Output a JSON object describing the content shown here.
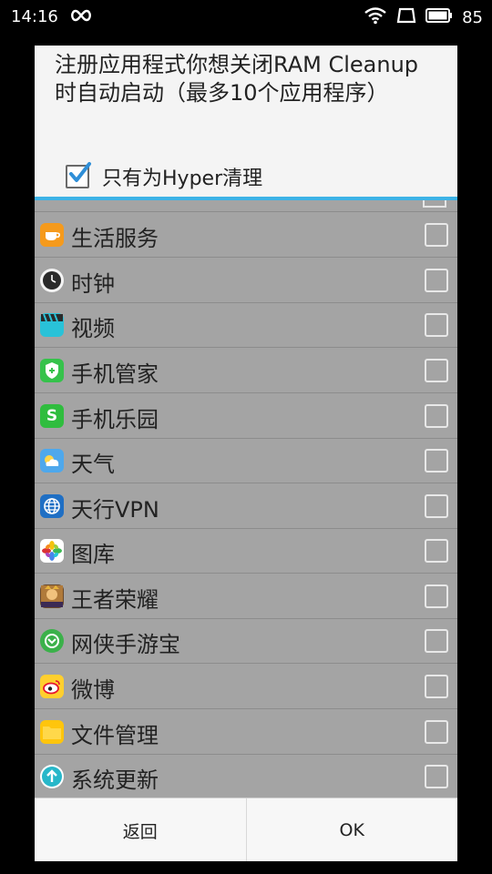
{
  "statusbar": {
    "time": "14:16",
    "battery_level": "85"
  },
  "dialog": {
    "title": "注册应用程式你想关闭RAM Cleanup时自动启动（最多10个应用程序）",
    "hyper_only_label": "只有为Hyper清理",
    "hyper_only_checked": true,
    "accent_color": "#3db3e6"
  },
  "apps": [
    {
      "label": "生活服务",
      "icon": "life-service-icon",
      "checked": false
    },
    {
      "label": "时钟",
      "icon": "clock-icon",
      "checked": false
    },
    {
      "label": "视频",
      "icon": "video-icon",
      "checked": false
    },
    {
      "label": "手机管家",
      "icon": "phone-manager-icon",
      "checked": false
    },
    {
      "label": "手机乐园",
      "icon": "phone-paradise-icon",
      "checked": false
    },
    {
      "label": "天气",
      "icon": "weather-icon",
      "checked": false
    },
    {
      "label": "天行VPN",
      "icon": "vpn-icon",
      "checked": false
    },
    {
      "label": "图库",
      "icon": "gallery-icon",
      "checked": false
    },
    {
      "label": "王者荣耀",
      "icon": "game-icon",
      "checked": false
    },
    {
      "label": "网侠手游宝",
      "icon": "game-store-icon",
      "checked": false
    },
    {
      "label": "微博",
      "icon": "weibo-icon",
      "checked": false
    },
    {
      "label": "文件管理",
      "icon": "file-manager-icon",
      "checked": false
    },
    {
      "label": "系统更新",
      "icon": "system-update-icon",
      "checked": false
    }
  ],
  "footer": {
    "back_label": "返回",
    "ok_label": "OK"
  }
}
